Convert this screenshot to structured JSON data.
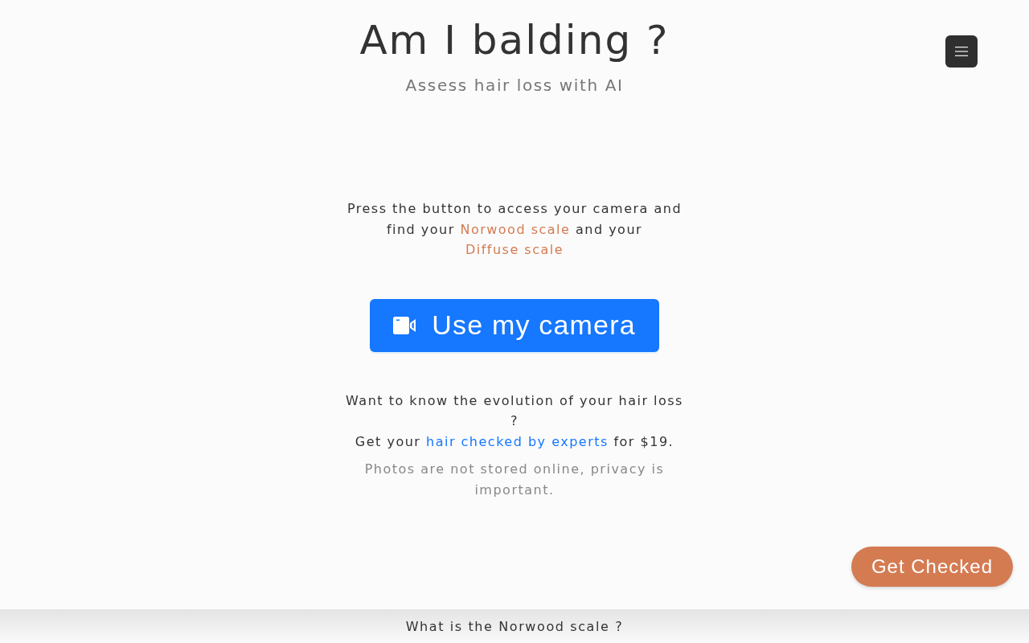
{
  "header": {
    "title": "Am I balding ?",
    "subtitle": "Assess hair loss with AI"
  },
  "intro": [
    {
      "kind": "text",
      "text": "Press the button to access your camera and find your "
    },
    {
      "kind": "link",
      "text": "Norwood scale"
    },
    {
      "kind": "text",
      "text": " and your "
    },
    {
      "kind": "link",
      "text": "Diffuse scale"
    }
  ],
  "camera_button": {
    "label": "Use my camera"
  },
  "evolution": {
    "question": "Want to know the evolution of your hair loss ?",
    "offer": [
      {
        "kind": "text",
        "text": "Get your "
      },
      {
        "kind": "link",
        "text": "hair checked by experts"
      },
      {
        "kind": "text",
        "text": " for $19."
      }
    ]
  },
  "privacy_note": "Photos are not stored online, privacy is important.",
  "get_checked_button": {
    "label": "Get Checked"
  },
  "bottom_bar": {
    "label": "What is the Norwood scale ?"
  }
}
